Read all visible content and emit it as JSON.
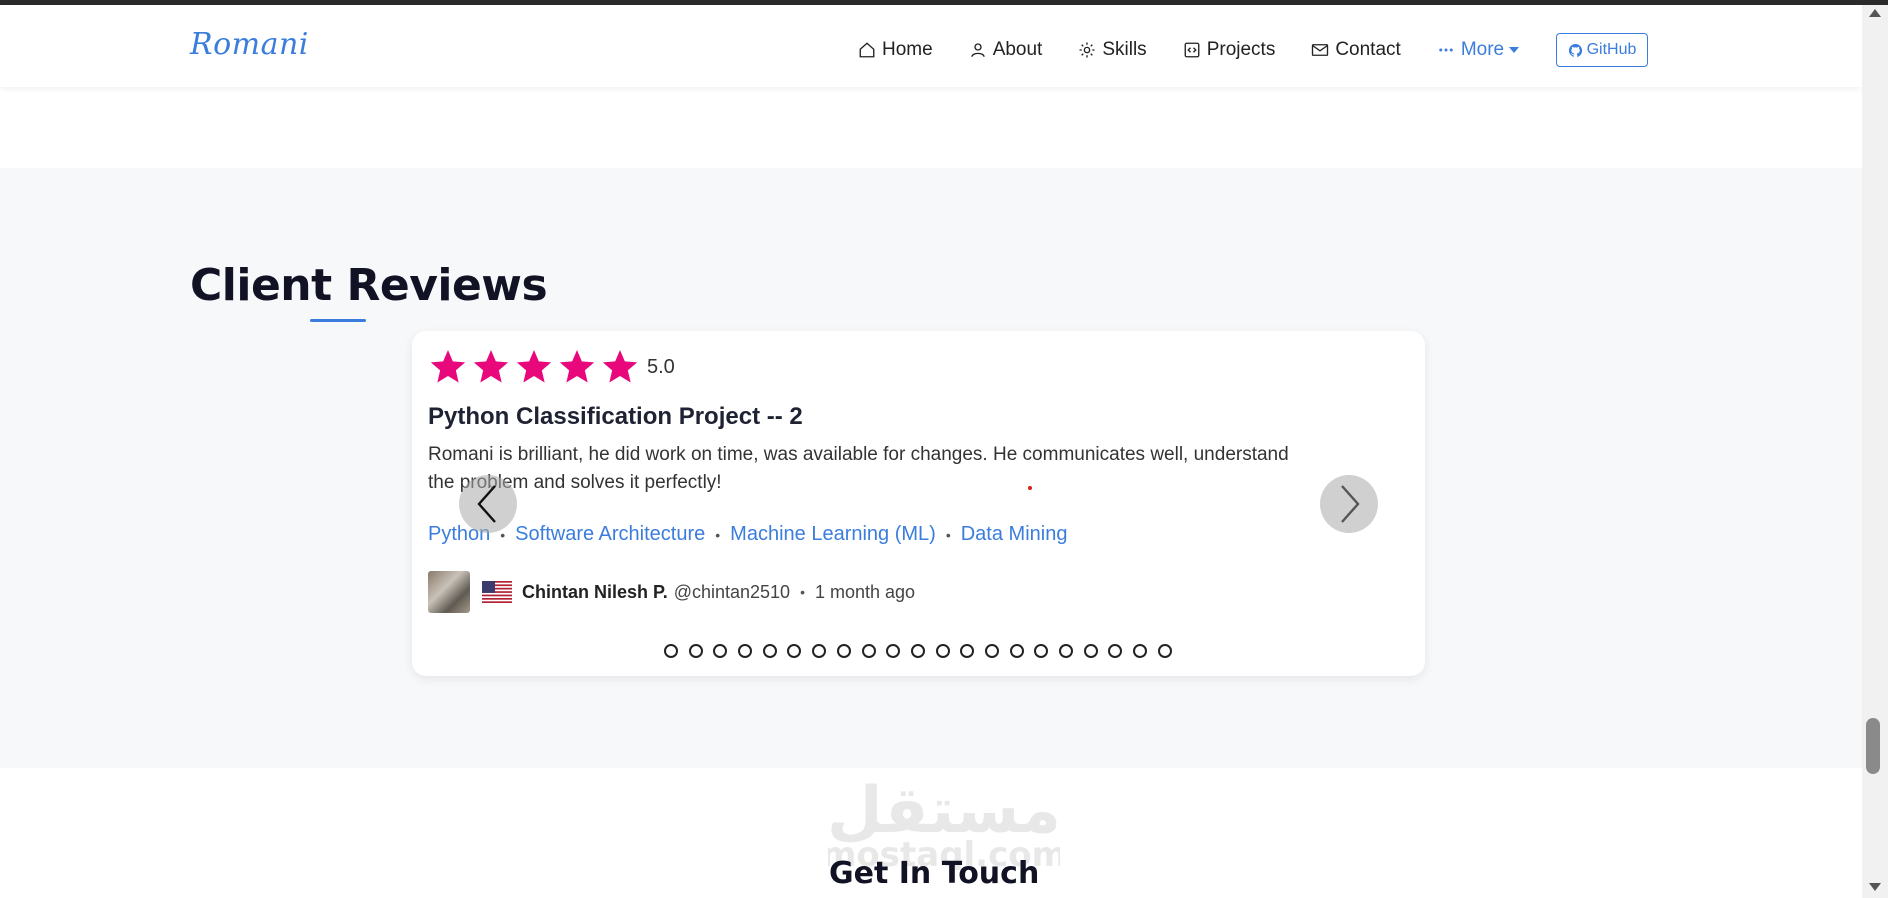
{
  "brand": {
    "name": "Romani",
    "color": "#3b7ddd"
  },
  "nav": {
    "items": [
      {
        "label": "Home",
        "icon": "home-icon"
      },
      {
        "label": "About",
        "icon": "user-icon"
      },
      {
        "label": "Skills",
        "icon": "gear-icon"
      },
      {
        "label": "Projects",
        "icon": "code-icon"
      },
      {
        "label": "Contact",
        "icon": "envelope-icon"
      }
    ],
    "more_label": "More",
    "github_label": "GitHub"
  },
  "reviews": {
    "section_title": "Client Reviews",
    "rating": "5.0",
    "rating_stars": 5,
    "star_color": "#e8087c",
    "title": "Python Classification Project -- 2",
    "text": "Romani is brilliant, he did work on time, was available for changes. He communicates well, understand the problem and solves it perfectly!",
    "tags": [
      "Python",
      "Software Architecture",
      "Machine Learning (ML)",
      "Data Mining"
    ],
    "reviewer": {
      "name": "Chintan Nilesh P.",
      "handle": "@chintan2510",
      "time": "1 month ago",
      "flag": "us-flag-icon"
    },
    "page_count": 21,
    "current_page": 1
  },
  "watermark": {
    "arabic": "مستقل",
    "latin": "mostaql.com"
  },
  "contact": {
    "title": "Get In Touch"
  }
}
